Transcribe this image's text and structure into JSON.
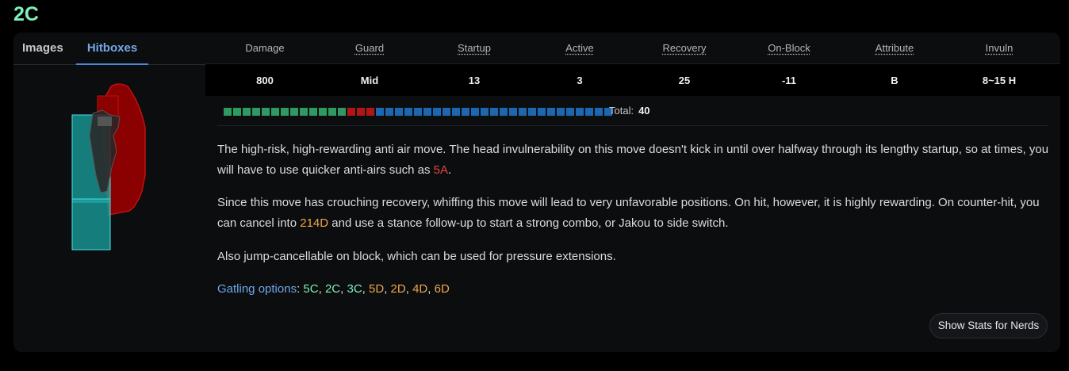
{
  "move": {
    "name": "2C"
  },
  "media": {
    "tabs": [
      {
        "label": "Images"
      },
      {
        "label": "Hitboxes"
      }
    ],
    "active_tab": "Hitboxes"
  },
  "stats": {
    "headers": [
      "Damage",
      "Guard",
      "Startup",
      "Active",
      "Recovery",
      "On-Block",
      "Attribute",
      "Invuln"
    ],
    "values": [
      "800",
      "Mid",
      "13",
      "3",
      "25",
      "-11",
      "B",
      "8~15 H"
    ]
  },
  "frame_data": {
    "startup_frames": 13,
    "active_frames": 3,
    "recovery_frames": 25,
    "total_label": "Total:",
    "total_value": "40",
    "colors": {
      "startup": "#2e9a62",
      "active": "#b01616",
      "recovery": "#1d67b0"
    }
  },
  "description": {
    "p1": {
      "text_a": "The high-risk, high-rewarding anti air move. The head invulnerability on this move doesn't kick in until over halfway through its lengthy startup, so at times, you will have to use quicker anti-airs such as ",
      "link": "5A",
      "text_b": "."
    },
    "p2": {
      "text_a": "Since this move has crouching recovery, whiffing this move will lead to very unfavorable positions. On hit, however, it is highly rewarding. On counter-hit, you can cancel into ",
      "link": "214D",
      "text_b": " and use a stance follow-up to start a strong combo, or Jakou to side switch."
    },
    "p3": {
      "text": "Also jump-cancellable on block, which can be used for pressure extensions."
    },
    "gatling": {
      "label": "Gatling options",
      "sep": ": ",
      "options": [
        {
          "name": "5C",
          "color": "green"
        },
        {
          "name": "2C",
          "color": "green"
        },
        {
          "name": "3C",
          "color": "green"
        },
        {
          "name": "5D",
          "color": "orange"
        },
        {
          "name": "2D",
          "color": "orange"
        },
        {
          "name": "4D",
          "color": "orange"
        },
        {
          "name": "6D",
          "color": "orange"
        }
      ],
      "comma": ", "
    }
  },
  "buttons": {
    "nerd_stats": "Show Stats for Nerds"
  },
  "colors": {
    "accent_green": "#7ef0b8",
    "tab_blue": "#74a7e6",
    "link_red": "#e24646",
    "link_orange": "#eda74a"
  }
}
